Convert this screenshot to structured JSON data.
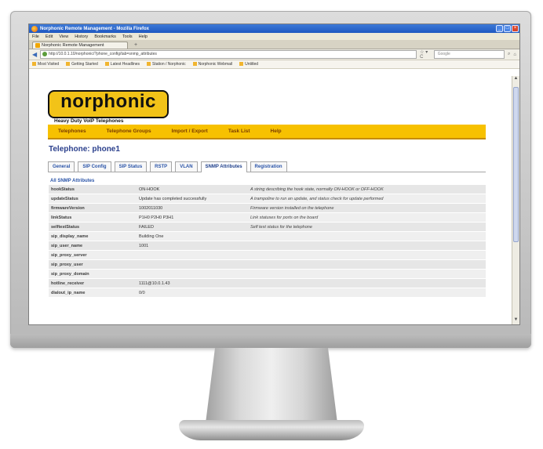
{
  "browser": {
    "window_title": "Norphonic Remote Management - Mozilla Firefox",
    "menu": [
      "File",
      "Edit",
      "View",
      "History",
      "Bookmarks",
      "Tools",
      "Help"
    ],
    "tab_label": "Norphonic Remote Management",
    "url": "http://10.0.1.10/norphonic/?phone_config/tab=snmp_attributes",
    "search_placeholder": "Google",
    "bookmarks": [
      "Most Visited",
      "Getting Started",
      "Latest Headlines",
      "Station / Norphonic",
      "Norphonic Webmail",
      "Untitled"
    ]
  },
  "app": {
    "logo_text": "norphonic",
    "logo_tagline": "Heavy Duty VoIP Telephones",
    "nav": [
      "Telephones",
      "Telephone Groups",
      "Import / Export",
      "Task List",
      "Help"
    ],
    "heading": "Telephone: phone1",
    "tabs": [
      "General",
      "SIP Config",
      "SIP Status",
      "RSTP",
      "VLAN",
      "SNMP Attributes",
      "Registration"
    ],
    "active_tab": "SNMP Attributes",
    "section_title": "All SNMP Attributes",
    "rows": [
      {
        "key": "hookStatus",
        "value": "ON-HOOK",
        "desc": "A string describing the hook state, normally ON-HOOK or OFF-HOOK"
      },
      {
        "key": "updateStatus",
        "value": "Update has completed successfully",
        "desc": "A trampoline to run an update, and status check for update performed"
      },
      {
        "key": "firmwareVersion",
        "value": "1002011030",
        "desc": "Firmware version installed on the telephone"
      },
      {
        "key": "linkStatus",
        "value": "P1H0 P2H0 P3H1",
        "desc": "Link statuses for ports on the board"
      },
      {
        "key": "selftestStatus",
        "value": "FAILED",
        "desc": "Self test status for the telephone"
      },
      {
        "key": "sip_display_name",
        "value": "Building One",
        "desc": ""
      },
      {
        "key": "sip_user_name",
        "value": "1001",
        "desc": ""
      },
      {
        "key": "sip_proxy_server",
        "value": "",
        "desc": ""
      },
      {
        "key": "sip_proxy_user",
        "value": "",
        "desc": ""
      },
      {
        "key": "sip_proxy_domain",
        "value": "",
        "desc": ""
      },
      {
        "key": "hotline_receiver",
        "value": "1111@10.0.1.43",
        "desc": ""
      },
      {
        "key": "dialout_ip_name",
        "value": "0/0",
        "desc": ""
      }
    ]
  }
}
